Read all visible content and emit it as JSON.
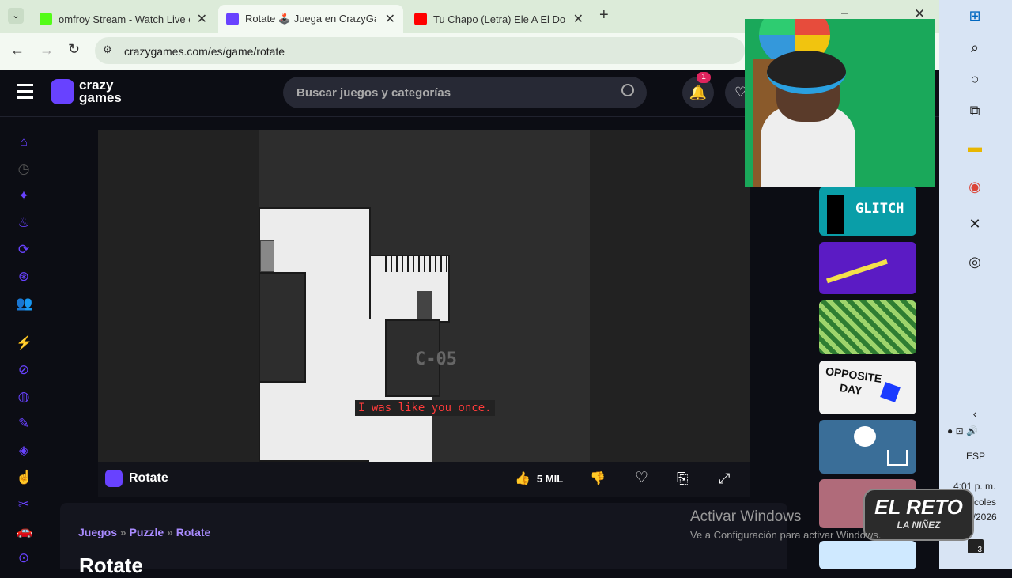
{
  "browser": {
    "tabs": [
      {
        "title": "omfroy Stream - Watch Live on",
        "color": "#53fc18"
      },
      {
        "title": "Rotate 🕹️ Juega en CrazyGames",
        "color": "#6842ff"
      },
      {
        "title": "Tu Chapo (Letra) Ele A El Domin",
        "color": "#ff0000"
      }
    ],
    "url": "crazygames.com/es/game/rotate"
  },
  "site": {
    "logo_line1": "crazy",
    "logo_line2": "games",
    "search_placeholder": "Buscar juegos y categorías",
    "notif_count": "1",
    "game_title": "Rotate",
    "likes": "5 MIL",
    "breadcrumb": [
      "Juegos",
      "Puzzle",
      "Rotate"
    ],
    "page_heading": "Rotate"
  },
  "game": {
    "level": "C-05",
    "caption": "I was like you once."
  },
  "rail": {
    "glitch": "GLITCH",
    "opposite1": "OPPOSITE",
    "opposite2": "DAY"
  },
  "overlay": {
    "activate_title": "Activar Windows",
    "activate_sub": "Ve a Configuración para activar Windows.",
    "reto1": "EL RETO",
    "reto2": "LA NIÑEZ"
  },
  "taskbar": {
    "time": "4:01 p. m.",
    "day": "coles",
    "date": "2/2026",
    "lang": "ESP",
    "chat_count": "3"
  },
  "colors": {
    "brand": "#6842ff",
    "caption": "#ff3b3b"
  }
}
